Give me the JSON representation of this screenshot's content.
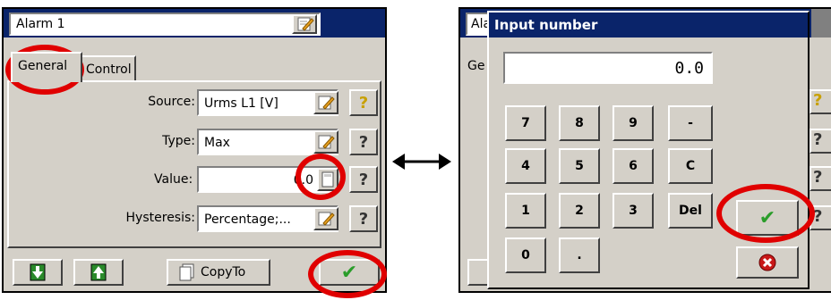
{
  "left_window": {
    "title_value": "Alarm 1",
    "tabs": [
      "General",
      "Control"
    ],
    "rows": [
      {
        "label": "Source:",
        "value": "Urms L1 [V]"
      },
      {
        "label": "Type:",
        "value": "Max"
      },
      {
        "label": "Value:",
        "value": "0.0"
      },
      {
        "label": "Hysteresis:",
        "value": "Percentage;..."
      }
    ],
    "copy_label": "CopyTo",
    "help_glyph": "?"
  },
  "arrow": "⟷",
  "right_window": {
    "behind_title": "Ala",
    "behind_tab": "Ge",
    "dialog_title": "Input number",
    "display_value": "0.0",
    "keys": [
      "7",
      "8",
      "9",
      "-",
      "4",
      "5",
      "6",
      "C",
      "1",
      "2",
      "3",
      "Del",
      "0",
      "."
    ]
  },
  "icons": {
    "ok": "check-icon",
    "cancel": "cancel-icon",
    "down": "arrow-down-icon",
    "up": "arrow-up-icon"
  },
  "colors": {
    "title_bar": "#0a246a",
    "face": "#d4d0c8",
    "ring": "#e00000",
    "ok_green": "#2a9d2a"
  }
}
